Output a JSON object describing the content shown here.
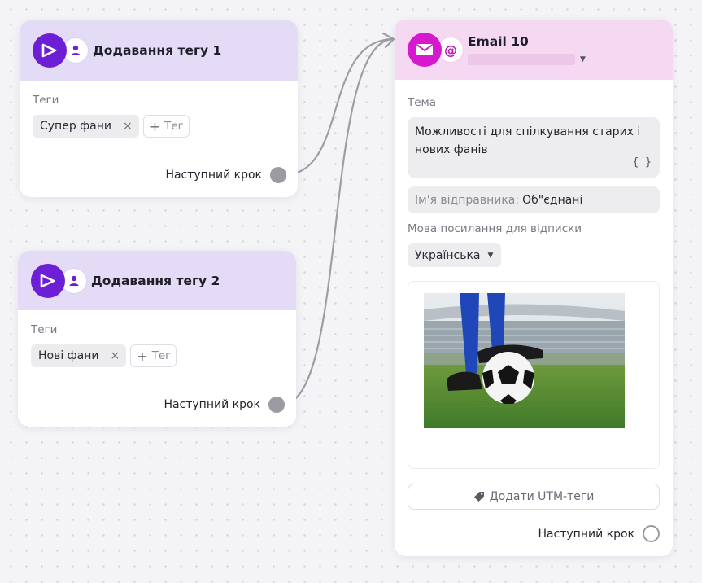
{
  "nodes": [
    {
      "title": "Додавання тегу 1",
      "field_label": "Теги",
      "tag": "Супер фани",
      "remove_tag_glyph": "×",
      "add_tag_label": "Тег",
      "next_step_label": "Наступний крок",
      "icons": [
        "play-icon",
        "user-icon",
        "close-icon",
        "plus-icon"
      ]
    },
    {
      "title": "Додавання тегу 2",
      "field_label": "Теги",
      "tag": "Нові фани",
      "remove_tag_glyph": "×",
      "add_tag_label": "Тег",
      "next_step_label": "Наступний крок",
      "icons": [
        "play-icon",
        "user-icon",
        "close-icon",
        "plus-icon"
      ]
    }
  ],
  "email": {
    "title": "Email 10",
    "subject_label": "Тема",
    "subject_line1": "Можливості для спілкування старих і",
    "subject_line2": "нових фанів",
    "subject_braces": "{ }",
    "sender_name_label": "Ім'я відправника:",
    "sender_name": "Об\"єднані",
    "unsubscribe_lang_label": "Мова посилання для відписки",
    "unsubscribe_lang": "Українська",
    "utm_button": "Додати UTM-теги",
    "next_step_label": "Наступний крок",
    "icons": [
      "envelope-icon",
      "at-icon",
      "chevron-down-icon",
      "tag-icon"
    ]
  },
  "colors": {
    "tag_node_header": "#e4dcf6",
    "tag_node_icon": "#6d1fd6",
    "email_node_header": "#f5d8f1",
    "email_node_icon": "#d618cf",
    "connector": "#9d9da6",
    "port": "#9b9ba4"
  }
}
